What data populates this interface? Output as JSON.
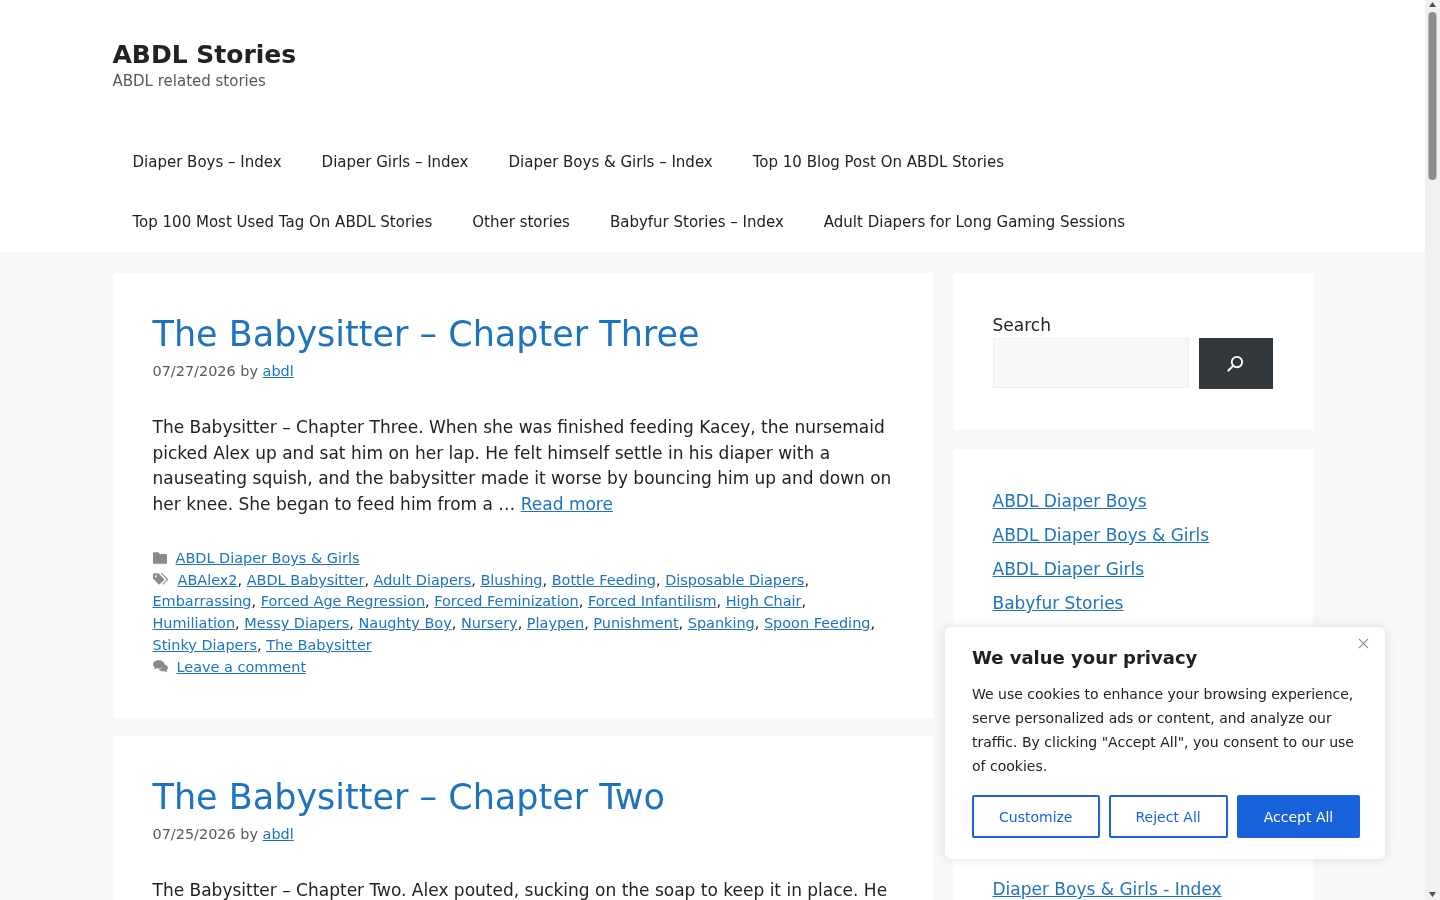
{
  "site": {
    "title": "ABDL Stories",
    "tagline": "ABDL related stories"
  },
  "nav": {
    "items": [
      "Diaper Boys – Index",
      "Diaper Girls – Index",
      "Diaper Boys & Girls – Index",
      "Top 10 Blog Post On ABDL Stories",
      "Top 100 Most Used Tag On ABDL Stories",
      "Other stories",
      "Babyfur Stories – Index",
      "Adult Diapers for Long Gaming Sessions"
    ]
  },
  "posts": [
    {
      "title": "The Babysitter – Chapter Three",
      "date": "07/27/2026",
      "by_label": "by",
      "author": "abdl",
      "excerpt": "The Babysitter – Chapter Three. When she was finished feeding Kacey, the nursemaid picked Alex up and sat him on her lap. He felt himself settle in his diaper with a nauseating squish, and the babysitter made it worse by bouncing him up and down on her knee. She began to feed him from a …",
      "read_more": "Read more",
      "list_separator": ", ",
      "categories": [
        "ABDL Diaper Boys & Girls"
      ],
      "tags": [
        "ABAlex2",
        "ABDL Babysitter",
        "Adult Diapers",
        "Blushing",
        "Bottle Feeding",
        "Disposable Diapers",
        "Embarrassing",
        "Forced Age Regression",
        "Forced Feminization",
        "Forced Infantilism",
        "High Chair",
        "Humiliation",
        "Messy Diapers",
        "Naughty Boy",
        "Nursery",
        "Playpen",
        "Punishment",
        "Spanking",
        "Spoon Feeding",
        "Stinky Diapers",
        "The Babysitter"
      ],
      "comments_link": "Leave a comment"
    },
    {
      "title": "The Babysitter – Chapter Two",
      "date": "07/25/2026",
      "by_label": "by",
      "author": "abdl",
      "excerpt": "The Babysitter – Chapter Two. Alex pouted, sucking on the soap to keep it in place. He"
    }
  ],
  "sidebar": {
    "search": {
      "label": "Search"
    },
    "category_links": [
      "ABDL Diaper Boys",
      "ABDL Diaper Boys & Girls",
      "ABDL Diaper Girls",
      "Babyfur Stories"
    ],
    "page_links": [
      "Diaper Boys & Girls - Index"
    ]
  },
  "cookie_banner": {
    "title": "We value your privacy",
    "text": "We use cookies to enhance your browsing experience, serve personalized ads or content, and analyze our traffic. By clicking \"Accept All\", you consent to our use of cookies.",
    "buttons": [
      {
        "label": "Customize",
        "kind": "outline"
      },
      {
        "label": "Reject All",
        "kind": "outline"
      },
      {
        "label": "Accept All",
        "kind": "primary"
      }
    ]
  }
}
